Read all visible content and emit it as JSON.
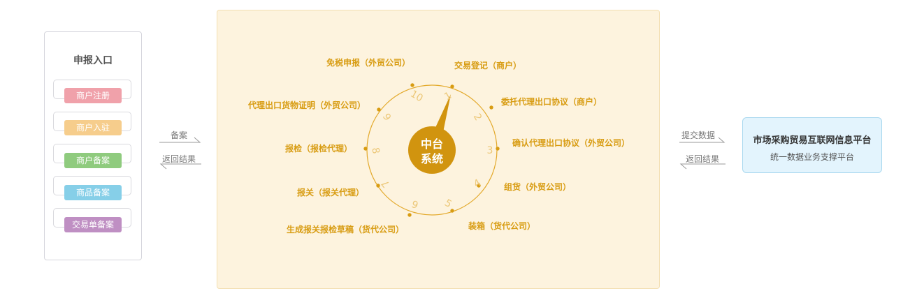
{
  "left": {
    "title": "申报入口",
    "items": [
      {
        "label": "商户注册",
        "color": "#f0a1aa"
      },
      {
        "label": "商户入驻",
        "color": "#f6cd8c"
      },
      {
        "label": "商户备案",
        "color": "#8fcb7e"
      },
      {
        "label": "商品备案",
        "color": "#86cfe8"
      },
      {
        "label": "交易单备案",
        "color": "#bf8fc3"
      }
    ]
  },
  "left_arrows": {
    "top": "备案",
    "bottom": "返回结果"
  },
  "center": {
    "hub_line1": "中台",
    "hub_line2": "系统",
    "colors": {
      "accent": "#d89c12",
      "hub": "#d1940f",
      "numeral": "#ecc777",
      "panel": "#fdf3de"
    },
    "steps": [
      {
        "num": "1",
        "label": "交易登记（商户）"
      },
      {
        "num": "2",
        "label": "委托代理出口协议（商户）"
      },
      {
        "num": "3",
        "label": "确认代理出口协议（外贸公司）"
      },
      {
        "num": "4",
        "label": "组货（外贸公司）"
      },
      {
        "num": "5",
        "label": "装箱（货代公司）"
      },
      {
        "num": "6",
        "label": "生成报关报检草稿（货代公司）"
      },
      {
        "num": "7",
        "label": "报关（报关代理）"
      },
      {
        "num": "8",
        "label": "报检（报检代理）"
      },
      {
        "num": "9",
        "label": "代理出口货物证明（外贸公司）"
      },
      {
        "num": "10",
        "label": "免税申报（外贸公司）"
      }
    ]
  },
  "right_arrows": {
    "top": "提交数据",
    "bottom": "返回结果"
  },
  "right": {
    "title": "市场采购贸易互联网信息平台",
    "subtitle": "统一数据业务支撑平台"
  }
}
